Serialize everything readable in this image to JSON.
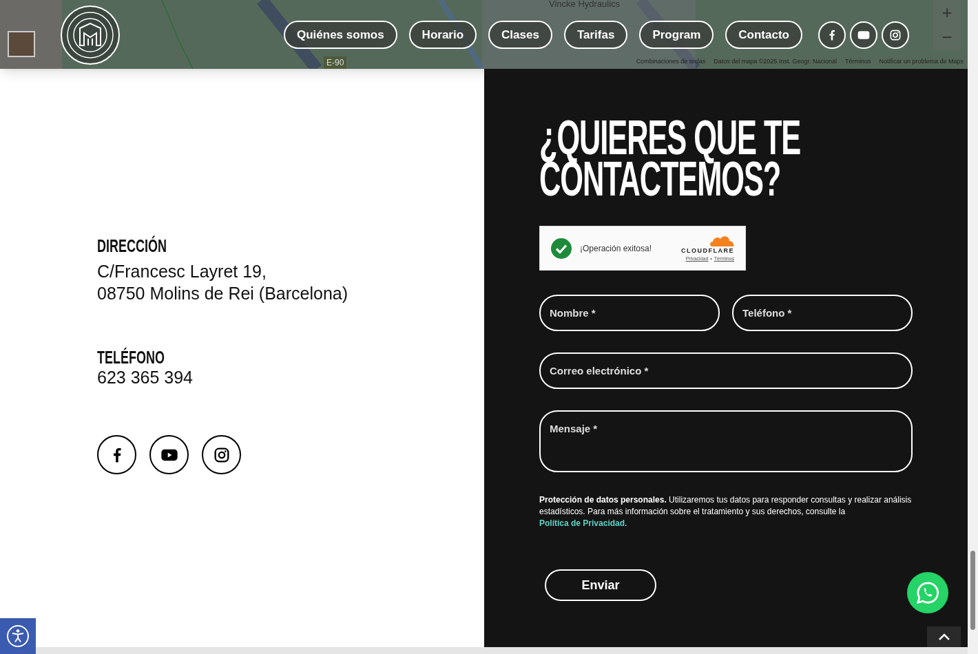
{
  "header": {
    "nav": [
      {
        "label": "Quiénes somos"
      },
      {
        "label": "Horario"
      },
      {
        "label": "Clases"
      },
      {
        "label": "Tarifas"
      },
      {
        "label": "Program"
      },
      {
        "label": "Contacto"
      }
    ],
    "social": [
      {
        "kind": "facebook"
      },
      {
        "kind": "youtube"
      },
      {
        "kind": "instagram"
      }
    ],
    "map": {
      "labels": [
        "Vincke Hydraulics",
        "E-90"
      ],
      "zoom_in": "+",
      "zoom_out": "−",
      "footer": [
        "Combinaciones de teclas",
        "Datos del mapa ©2025 Inst. Geogr. Nacional",
        "Términos",
        "Notificar un problema de Maps"
      ]
    }
  },
  "info": {
    "sections": [
      {
        "heading": "DIRECCIÓN",
        "lines": [
          "C/Francesc Layret 19,",
          "08750 Molins de Rei (Barcelona)"
        ]
      },
      {
        "heading": "TELÉFONO",
        "lines": [
          "623 365 394"
        ]
      }
    ],
    "social": [
      {
        "kind": "facebook"
      },
      {
        "kind": "youtube"
      },
      {
        "kind": "instagram"
      }
    ]
  },
  "form": {
    "title_lines": [
      "¿QUIERES QUE TE",
      "CONTACTEMOS?"
    ],
    "captcha": {
      "status": "¡Operación exitosa!",
      "brand": "CLOUDFLARE",
      "links": [
        "Privacidad",
        "Términos"
      ],
      "separator": "•"
    },
    "fields": [
      {
        "placeholder": "Nombre *",
        "kind": "half"
      },
      {
        "placeholder": "Teléfono *",
        "kind": "half"
      },
      {
        "placeholder": "Correo electrónico *",
        "kind": "wide"
      },
      {
        "placeholder": "Mensaje *",
        "kind": "textarea"
      }
    ],
    "privacy": {
      "text": "**Protección de datos personales.** Utilizaremos tus datos para responder consultas y realizar análisis estadísticos. Para más información sobre el tratamiento y sus derechos, consulte la",
      "link": "Política de Privacidad",
      "after": "."
    },
    "submit": "Enviar"
  }
}
